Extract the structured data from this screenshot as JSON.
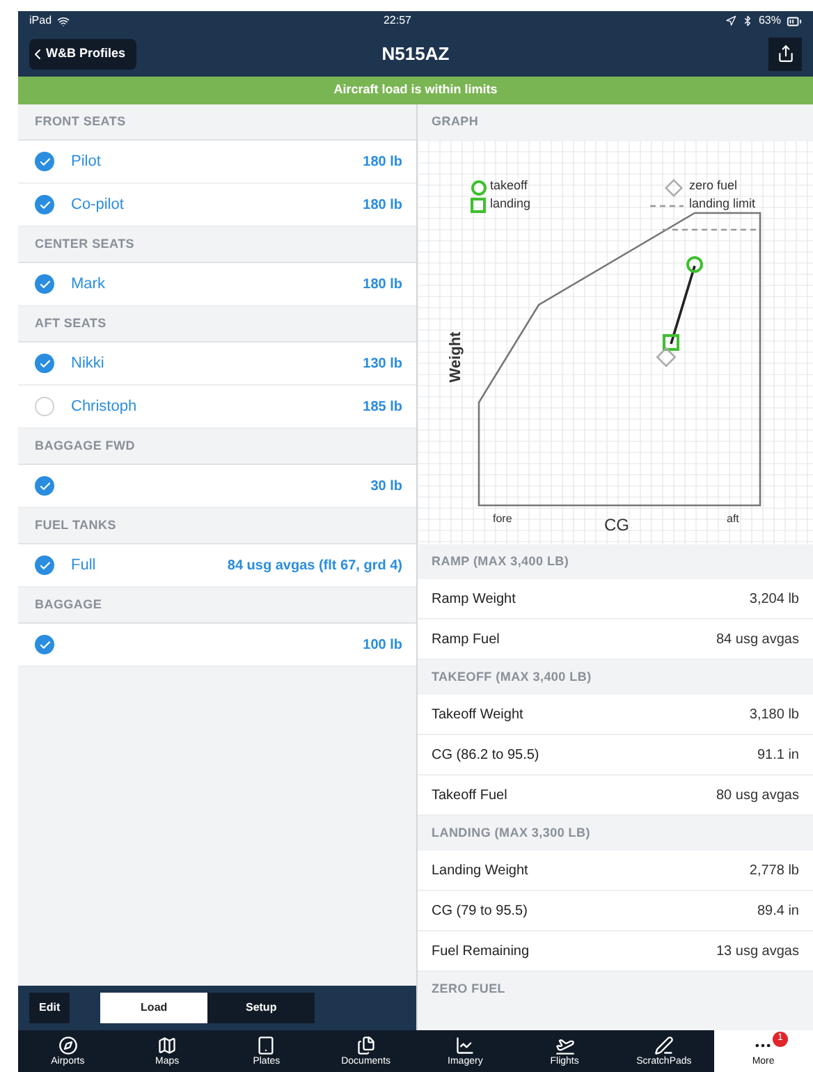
{
  "status_bar": {
    "device": "iPad",
    "time": "22:57",
    "battery": "63%"
  },
  "nav": {
    "back": "W&B Profiles",
    "title": "N515AZ"
  },
  "banner": "Aircraft load is within limits",
  "load_sections": [
    {
      "title": "FRONT SEATS",
      "items": [
        {
          "label": "Pilot",
          "value": "180 lb",
          "checked": true
        },
        {
          "label": "Co-pilot",
          "value": "180 lb",
          "checked": true
        }
      ]
    },
    {
      "title": "CENTER SEATS",
      "items": [
        {
          "label": "Mark",
          "value": "180 lb",
          "checked": true
        }
      ]
    },
    {
      "title": "AFT SEATS",
      "items": [
        {
          "label": "Nikki",
          "value": "130 lb",
          "checked": true
        },
        {
          "label": "Christoph",
          "value": "185 lb",
          "checked": false
        }
      ]
    },
    {
      "title": "BAGGAGE FWD",
      "items": [
        {
          "value": "30 lb",
          "checked": true
        }
      ]
    },
    {
      "title": "FUEL TANKS",
      "items": [
        {
          "label": "Full",
          "value": "84 usg avgas (flt 67, grd 4)",
          "checked": true
        }
      ]
    },
    {
      "title": "BAGGAGE",
      "items": [
        {
          "value": "100 lb",
          "checked": true
        }
      ]
    }
  ],
  "left_toolbar": {
    "edit": "Edit",
    "segments": [
      {
        "label": "Load",
        "selected": true
      },
      {
        "label": "Setup",
        "selected": false
      }
    ]
  },
  "graph": {
    "title": "GRAPH",
    "legend": [
      "takeoff",
      "landing",
      "zero fuel",
      "landing limit"
    ],
    "xlabel": "CG",
    "ylabel": "Weight",
    "x_left": "fore",
    "x_right": "aft"
  },
  "result_sections": [
    {
      "title": "RAMP (MAX 3,400 LB)",
      "rows": [
        {
          "label": "Ramp Weight",
          "value": "3,204 lb"
        },
        {
          "label": "Ramp Fuel",
          "value": "84 usg avgas"
        }
      ]
    },
    {
      "title": "TAKEOFF (MAX 3,400 LB)",
      "rows": [
        {
          "label": "Takeoff Weight",
          "value": "3,180 lb"
        },
        {
          "label": "CG (86.2 to 95.5)",
          "value": "91.1 in"
        },
        {
          "label": "Takeoff Fuel",
          "value": "80 usg avgas"
        }
      ]
    },
    {
      "title": "LANDING (MAX 3,300 LB)",
      "rows": [
        {
          "label": "Landing Weight",
          "value": "2,778 lb"
        },
        {
          "label": "CG (79 to 95.5)",
          "value": "89.4 in"
        },
        {
          "label": "Fuel Remaining",
          "value": "13 usg avgas"
        }
      ]
    },
    {
      "title": "ZERO FUEL"
    }
  ],
  "tab_bar": [
    {
      "label": "Airports",
      "selected": false
    },
    {
      "label": "Maps",
      "selected": false
    },
    {
      "label": "Plates",
      "selected": false
    },
    {
      "label": "Documents",
      "selected": false
    },
    {
      "label": "Imagery",
      "selected": false
    },
    {
      "label": "Flights",
      "selected": false
    },
    {
      "label": "ScratchPads",
      "selected": false
    },
    {
      "label": "More",
      "selected": true,
      "badge": "1"
    }
  ]
}
